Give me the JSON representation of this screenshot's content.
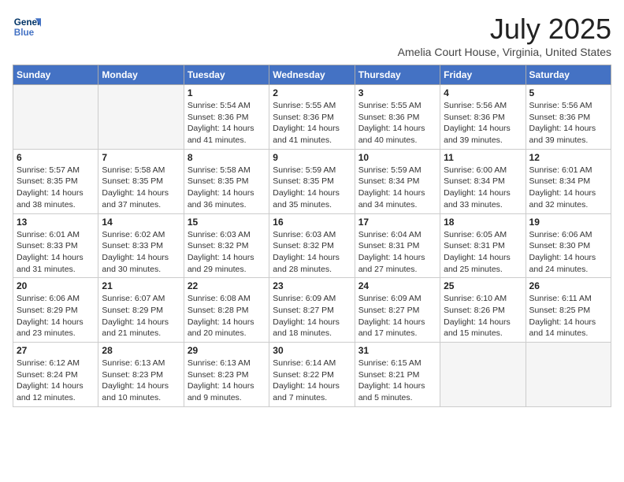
{
  "logo": {
    "line1": "General",
    "line2": "Blue"
  },
  "title": "July 2025",
  "location": "Amelia Court House, Virginia, United States",
  "headers": [
    "Sunday",
    "Monday",
    "Tuesday",
    "Wednesday",
    "Thursday",
    "Friday",
    "Saturday"
  ],
  "weeks": [
    [
      {
        "day": "",
        "detail": ""
      },
      {
        "day": "",
        "detail": ""
      },
      {
        "day": "1",
        "detail": "Sunrise: 5:54 AM\nSunset: 8:36 PM\nDaylight: 14 hours\nand 41 minutes."
      },
      {
        "day": "2",
        "detail": "Sunrise: 5:55 AM\nSunset: 8:36 PM\nDaylight: 14 hours\nand 41 minutes."
      },
      {
        "day": "3",
        "detail": "Sunrise: 5:55 AM\nSunset: 8:36 PM\nDaylight: 14 hours\nand 40 minutes."
      },
      {
        "day": "4",
        "detail": "Sunrise: 5:56 AM\nSunset: 8:36 PM\nDaylight: 14 hours\nand 39 minutes."
      },
      {
        "day": "5",
        "detail": "Sunrise: 5:56 AM\nSunset: 8:36 PM\nDaylight: 14 hours\nand 39 minutes."
      }
    ],
    [
      {
        "day": "6",
        "detail": "Sunrise: 5:57 AM\nSunset: 8:35 PM\nDaylight: 14 hours\nand 38 minutes."
      },
      {
        "day": "7",
        "detail": "Sunrise: 5:58 AM\nSunset: 8:35 PM\nDaylight: 14 hours\nand 37 minutes."
      },
      {
        "day": "8",
        "detail": "Sunrise: 5:58 AM\nSunset: 8:35 PM\nDaylight: 14 hours\nand 36 minutes."
      },
      {
        "day": "9",
        "detail": "Sunrise: 5:59 AM\nSunset: 8:35 PM\nDaylight: 14 hours\nand 35 minutes."
      },
      {
        "day": "10",
        "detail": "Sunrise: 5:59 AM\nSunset: 8:34 PM\nDaylight: 14 hours\nand 34 minutes."
      },
      {
        "day": "11",
        "detail": "Sunrise: 6:00 AM\nSunset: 8:34 PM\nDaylight: 14 hours\nand 33 minutes."
      },
      {
        "day": "12",
        "detail": "Sunrise: 6:01 AM\nSunset: 8:34 PM\nDaylight: 14 hours\nand 32 minutes."
      }
    ],
    [
      {
        "day": "13",
        "detail": "Sunrise: 6:01 AM\nSunset: 8:33 PM\nDaylight: 14 hours\nand 31 minutes."
      },
      {
        "day": "14",
        "detail": "Sunrise: 6:02 AM\nSunset: 8:33 PM\nDaylight: 14 hours\nand 30 minutes."
      },
      {
        "day": "15",
        "detail": "Sunrise: 6:03 AM\nSunset: 8:32 PM\nDaylight: 14 hours\nand 29 minutes."
      },
      {
        "day": "16",
        "detail": "Sunrise: 6:03 AM\nSunset: 8:32 PM\nDaylight: 14 hours\nand 28 minutes."
      },
      {
        "day": "17",
        "detail": "Sunrise: 6:04 AM\nSunset: 8:31 PM\nDaylight: 14 hours\nand 27 minutes."
      },
      {
        "day": "18",
        "detail": "Sunrise: 6:05 AM\nSunset: 8:31 PM\nDaylight: 14 hours\nand 25 minutes."
      },
      {
        "day": "19",
        "detail": "Sunrise: 6:06 AM\nSunset: 8:30 PM\nDaylight: 14 hours\nand 24 minutes."
      }
    ],
    [
      {
        "day": "20",
        "detail": "Sunrise: 6:06 AM\nSunset: 8:29 PM\nDaylight: 14 hours\nand 23 minutes."
      },
      {
        "day": "21",
        "detail": "Sunrise: 6:07 AM\nSunset: 8:29 PM\nDaylight: 14 hours\nand 21 minutes."
      },
      {
        "day": "22",
        "detail": "Sunrise: 6:08 AM\nSunset: 8:28 PM\nDaylight: 14 hours\nand 20 minutes."
      },
      {
        "day": "23",
        "detail": "Sunrise: 6:09 AM\nSunset: 8:27 PM\nDaylight: 14 hours\nand 18 minutes."
      },
      {
        "day": "24",
        "detail": "Sunrise: 6:09 AM\nSunset: 8:27 PM\nDaylight: 14 hours\nand 17 minutes."
      },
      {
        "day": "25",
        "detail": "Sunrise: 6:10 AM\nSunset: 8:26 PM\nDaylight: 14 hours\nand 15 minutes."
      },
      {
        "day": "26",
        "detail": "Sunrise: 6:11 AM\nSunset: 8:25 PM\nDaylight: 14 hours\nand 14 minutes."
      }
    ],
    [
      {
        "day": "27",
        "detail": "Sunrise: 6:12 AM\nSunset: 8:24 PM\nDaylight: 14 hours\nand 12 minutes."
      },
      {
        "day": "28",
        "detail": "Sunrise: 6:13 AM\nSunset: 8:23 PM\nDaylight: 14 hours\nand 10 minutes."
      },
      {
        "day": "29",
        "detail": "Sunrise: 6:13 AM\nSunset: 8:23 PM\nDaylight: 14 hours\nand 9 minutes."
      },
      {
        "day": "30",
        "detail": "Sunrise: 6:14 AM\nSunset: 8:22 PM\nDaylight: 14 hours\nand 7 minutes."
      },
      {
        "day": "31",
        "detail": "Sunrise: 6:15 AM\nSunset: 8:21 PM\nDaylight: 14 hours\nand 5 minutes."
      },
      {
        "day": "",
        "detail": ""
      },
      {
        "day": "",
        "detail": ""
      }
    ]
  ]
}
